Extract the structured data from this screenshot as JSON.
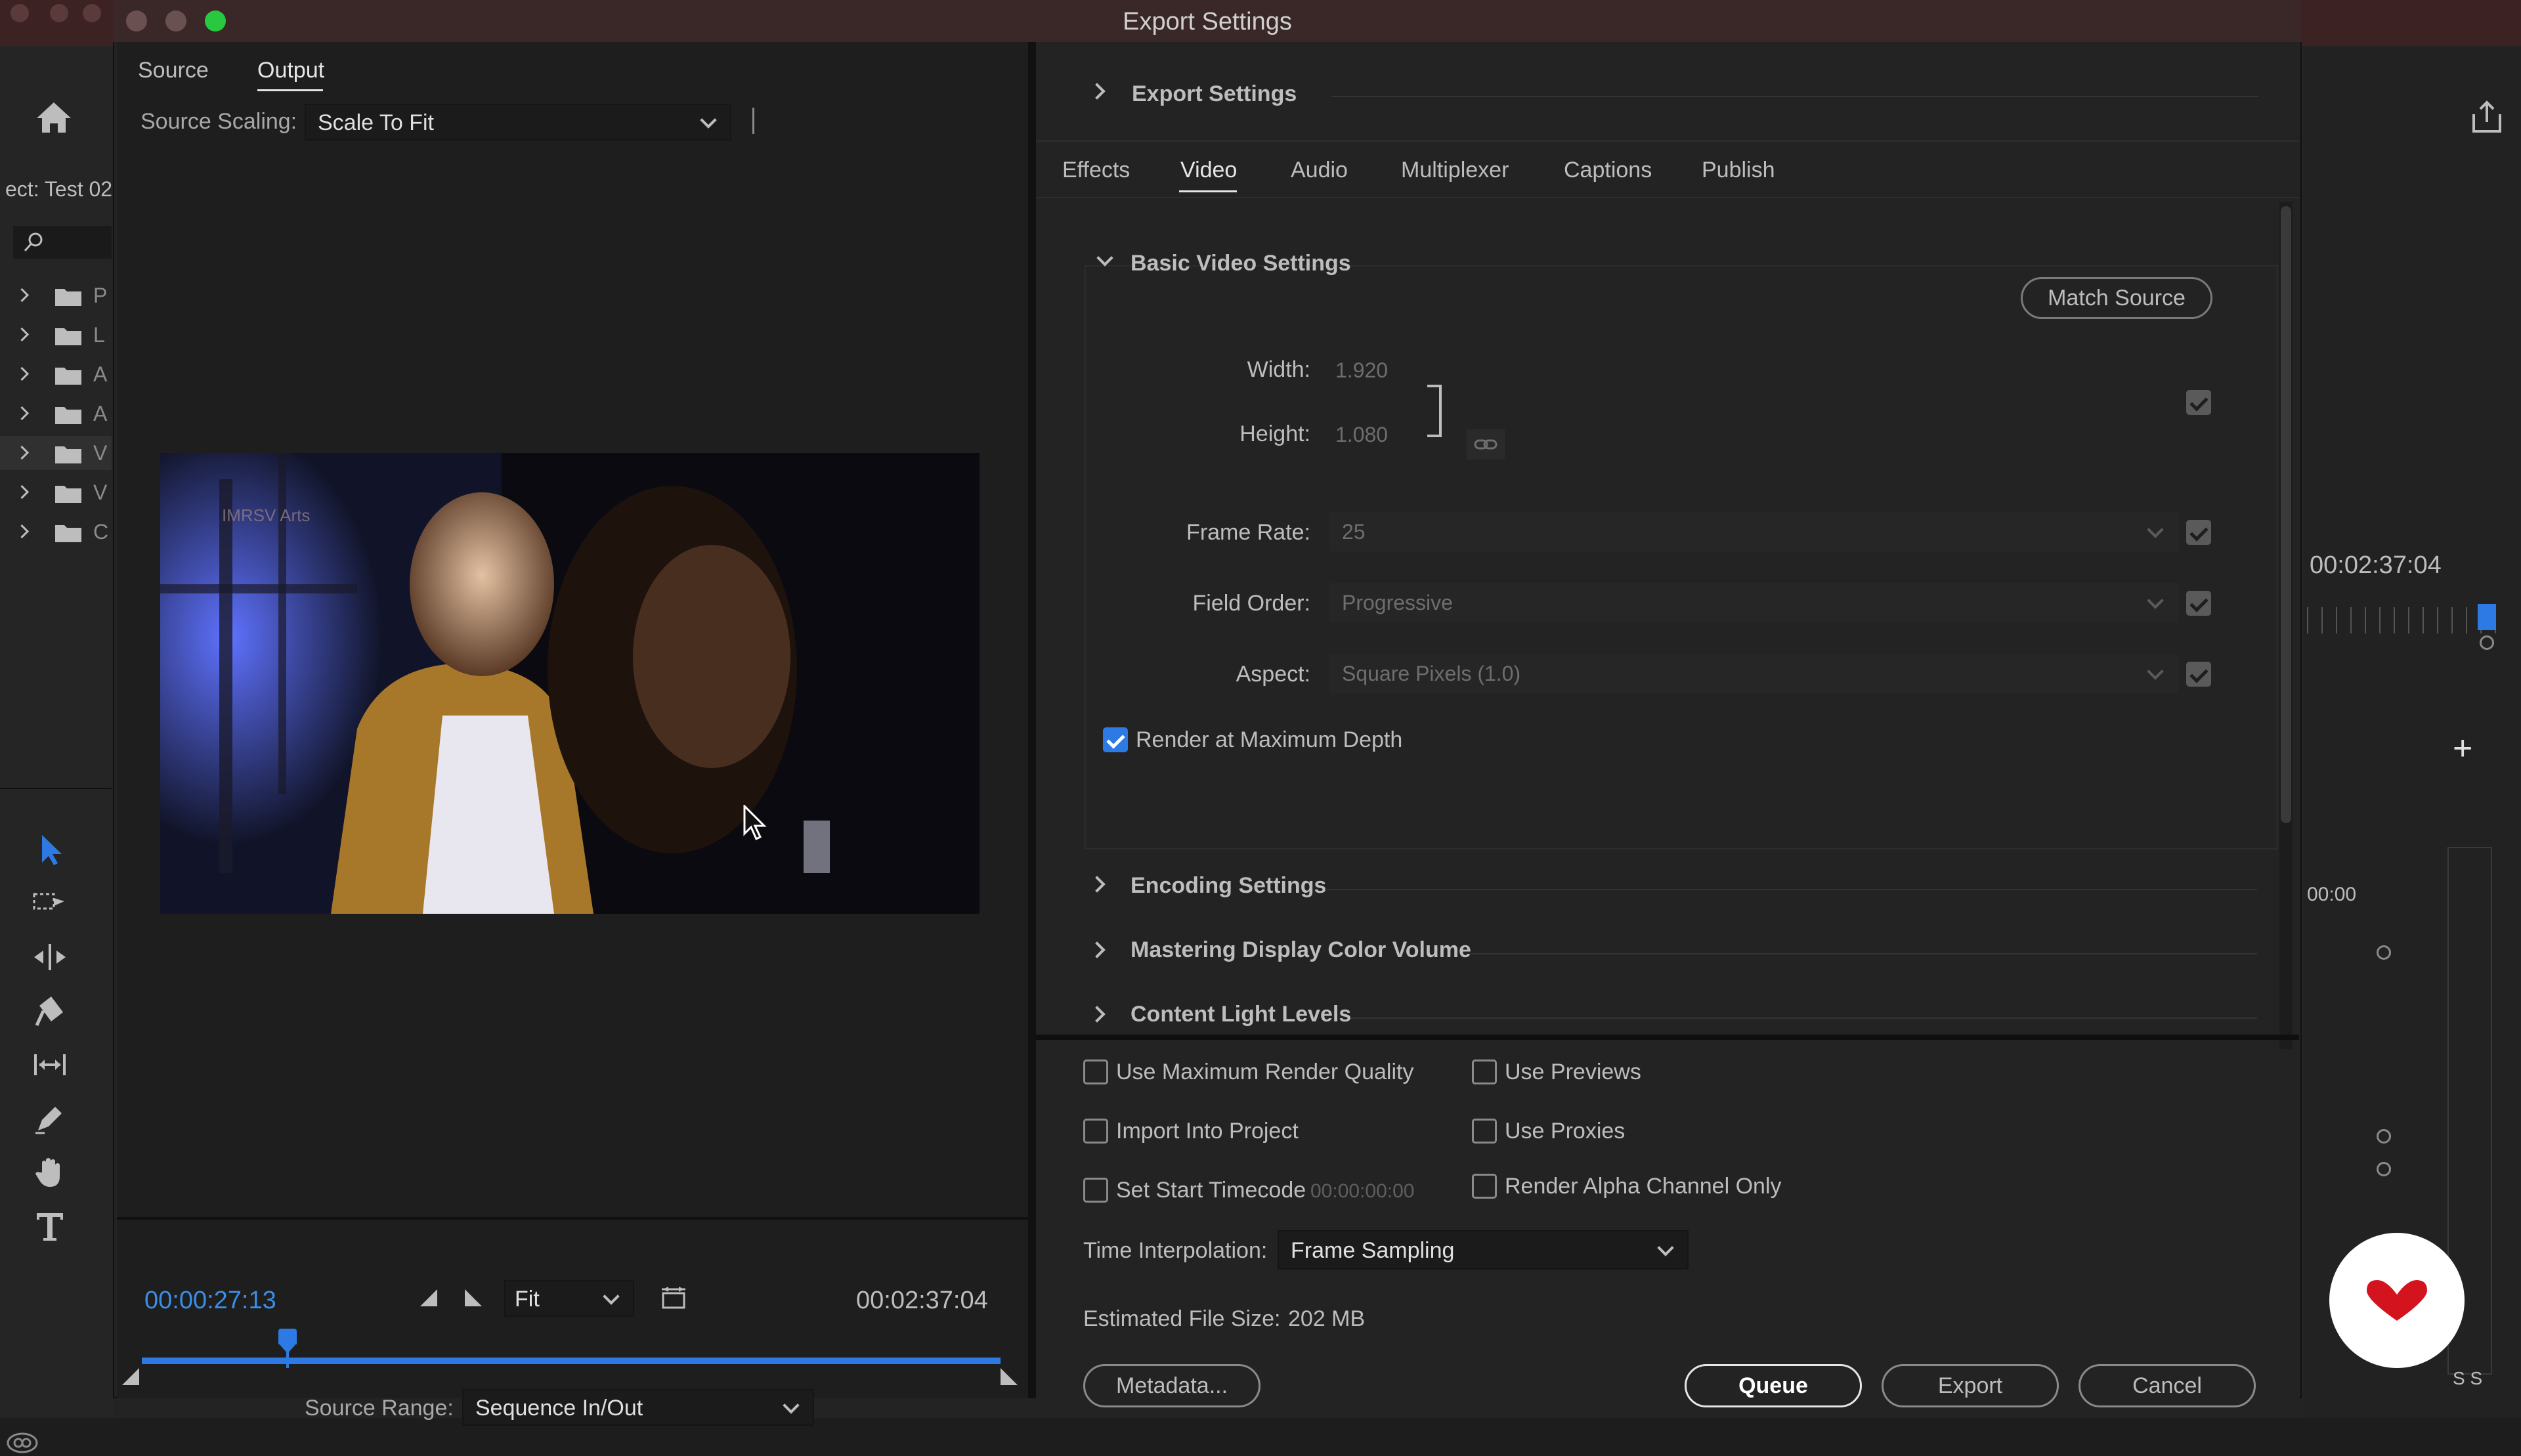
{
  "window": {
    "title": "Export Settings"
  },
  "background_app": {
    "project_label": "ect: Test 02",
    "bins": [
      "P",
      "L",
      "A",
      "A",
      "V",
      "V",
      "C"
    ],
    "timecode": "00:02:37:04",
    "small_timecode": "00:00",
    "track_labels": "S S"
  },
  "source_panel": {
    "tabs": [
      {
        "label": "Source"
      },
      {
        "label": "Output"
      }
    ],
    "scaling": {
      "label": "Source Scaling:",
      "value": "Scale To Fit"
    },
    "preview": {
      "watermark": "IMRSV Arts"
    },
    "timeline": {
      "current_time": "00:00:27:13",
      "duration": "00:02:37:04",
      "zoom": "Fit",
      "playhead_fraction": 0.17
    },
    "source_range": {
      "label": "Source Range:",
      "value": "Sequence In/Out"
    }
  },
  "export_settings": {
    "header": "Export Settings",
    "tabs": [
      {
        "label": "Effects"
      },
      {
        "label": "Video"
      },
      {
        "label": "Audio"
      },
      {
        "label": "Multiplexer"
      },
      {
        "label": "Captions"
      },
      {
        "label": "Publish"
      }
    ],
    "active_tab": "Video",
    "basic_video": {
      "title": "Basic Video Settings",
      "match_source": "Match Source",
      "width": {
        "label": "Width:",
        "value": "1.920"
      },
      "height": {
        "label": "Height:",
        "value": "1.080"
      },
      "frame_rate": {
        "label": "Frame Rate:",
        "value": "25"
      },
      "field_order": {
        "label": "Field Order:",
        "value": "Progressive"
      },
      "aspect": {
        "label": "Aspect:",
        "value": "Square Pixels (1.0)"
      },
      "render_max_depth": {
        "label": "Render at Maximum Depth",
        "checked": true
      }
    },
    "sections": [
      {
        "title": "Encoding Settings"
      },
      {
        "title": "Mastering Display Color Volume"
      },
      {
        "title": "Content Light Levels"
      }
    ]
  },
  "options": {
    "use_max_render_quality": "Use Maximum Render Quality",
    "use_previews": "Use Previews",
    "import_into_project": "Import Into Project",
    "use_proxies": "Use Proxies",
    "set_start_timecode": "Set Start Timecode",
    "start_timecode_value": "00:00:00:00",
    "render_alpha_only": "Render Alpha Channel Only",
    "time_interpolation": {
      "label": "Time Interpolation:",
      "value": "Frame Sampling"
    },
    "file_size": {
      "label": "Estimated File Size:",
      "value": "202 MB"
    }
  },
  "buttons": {
    "metadata": "Metadata...",
    "queue": "Queue",
    "export": "Export",
    "cancel": "Cancel"
  },
  "colors": {
    "accent": "#2d7ae5",
    "timecode_blue": "#3a8ee6",
    "brand_red": "#d3141f"
  }
}
